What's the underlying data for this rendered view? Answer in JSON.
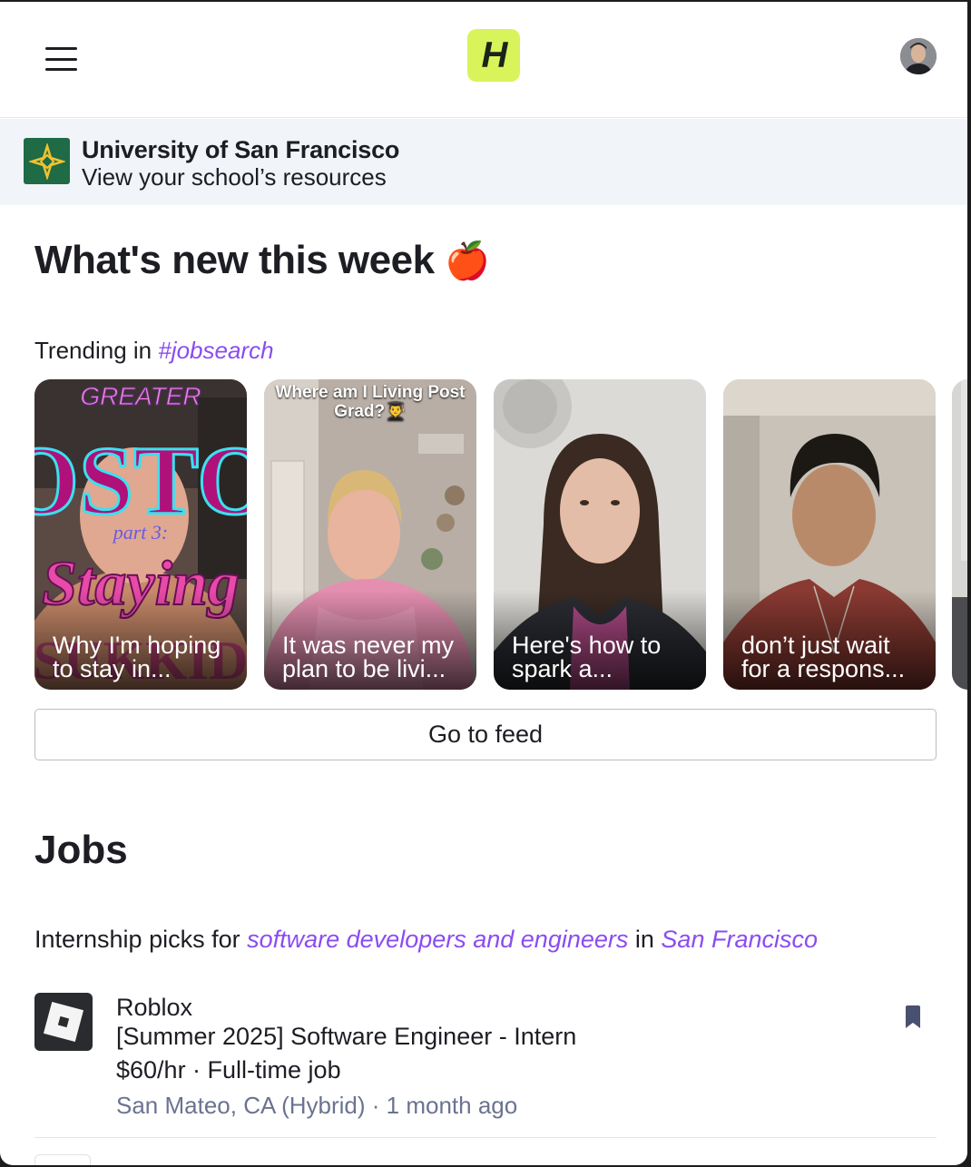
{
  "nav": {
    "logo_letter": "H"
  },
  "school": {
    "name": "University of San Francisco",
    "subtitle": "View your school’s resources"
  },
  "whats_new": {
    "heading": "What's new this week",
    "emoji": "🍎"
  },
  "trending": {
    "prefix": "Trending in ",
    "hashtag": "#jobsearch",
    "cards": [
      {
        "caption": "Why I'm hoping to stay in...",
        "overlay": ""
      },
      {
        "caption": "It was never my plan to be livi...",
        "overlay": "Where am I Living Post Grad?👨‍🎓"
      },
      {
        "caption": "Here's how to spark a...",
        "overlay": ""
      },
      {
        "caption": "don’t just wait for a respons...",
        "overlay": ""
      }
    ],
    "feed_button": "Go to feed"
  },
  "jobs": {
    "heading": "Jobs",
    "picks_prefix": "Internship picks for ",
    "picks_role": "software developers and engineers",
    "picks_in": " in ",
    "picks_city": "San Francisco",
    "items": [
      {
        "company": "Roblox",
        "title": "[Summer 2025] Software Engineer - Intern",
        "pay": "$60/hr · Full-time job",
        "location": "San Mateo, CA (Hybrid) · 1 month ago"
      }
    ]
  },
  "colors": {
    "accent": "#8b4cf0",
    "logo_bg": "#d8f45a",
    "banner_bg": "#f1f4f9"
  }
}
